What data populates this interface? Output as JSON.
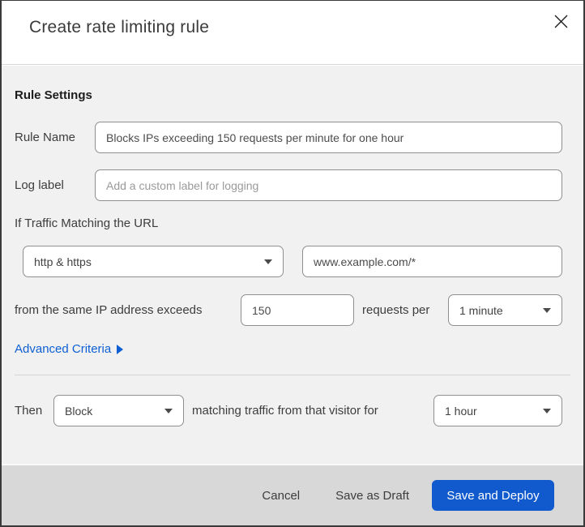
{
  "header": {
    "title": "Create rate limiting rule"
  },
  "rule_settings": {
    "heading": "Rule Settings"
  },
  "rule_name": {
    "label": "Rule Name",
    "value": "Blocks IPs exceeding 150 requests per minute for one hour"
  },
  "log_label": {
    "label": "Log label",
    "placeholder": "Add a custom label for logging"
  },
  "traffic": {
    "heading": "If Traffic Matching the URL",
    "scheme_selected": "http & https",
    "url_value": "www.example.com/*",
    "threshold_prefix": "from the same IP address exceeds",
    "requests_value": "150",
    "threshold_middle": "requests per",
    "period_selected": "1 minute",
    "advanced_link": "Advanced Criteria"
  },
  "action": {
    "then_label": "Then",
    "action_selected": "Block",
    "middle_text": "matching traffic from that visitor for",
    "duration_selected": "1 hour"
  },
  "footer": {
    "cancel_label": "Cancel",
    "save_draft_label": "Save as Draft",
    "save_deploy_label": "Save and Deploy"
  },
  "colors": {
    "link_blue": "#0d5fd3",
    "button_blue": "#105acd",
    "body_bg": "#f1f1f1",
    "footer_bg": "#d8d8d8"
  }
}
